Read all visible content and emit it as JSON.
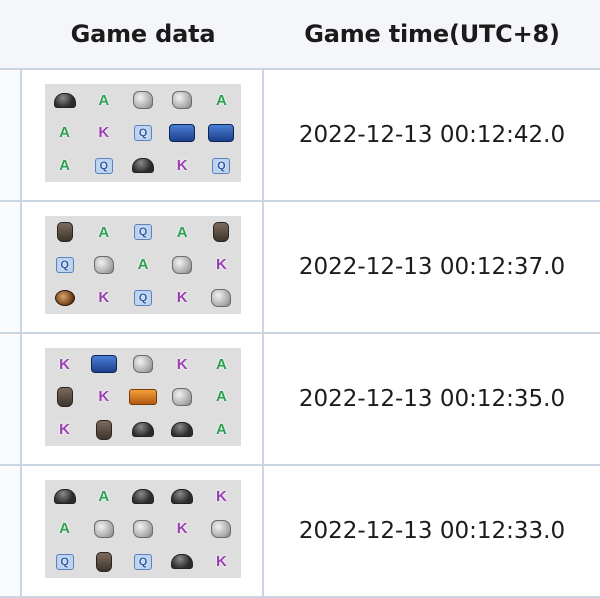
{
  "headers": {
    "game_data": "Game data",
    "game_time": "Game time(UTC+8)"
  },
  "rows": [
    {
      "time": "2022-12-13 00:12:42.0",
      "symbols": [
        [
          "helmet",
          "A",
          "rock",
          "rock",
          "A"
        ],
        [
          "A",
          "K",
          "Q",
          "wild",
          "wild"
        ],
        [
          "A",
          "Q",
          "helmet",
          "K",
          "Q"
        ]
      ]
    },
    {
      "time": "2022-12-13 00:12:37.0",
      "symbols": [
        [
          "bag",
          "A",
          "Q",
          "A",
          "bag"
        ],
        [
          "Q",
          "rock",
          "A",
          "rock",
          "K"
        ],
        [
          "bomb",
          "K",
          "Q",
          "K",
          "rock"
        ]
      ]
    },
    {
      "time": "2022-12-13 00:12:35.0",
      "symbols": [
        [
          "K",
          "wild",
          "rock",
          "K",
          "A"
        ],
        [
          "bag",
          "K",
          "scatter",
          "rock",
          "A"
        ],
        [
          "K",
          "bag",
          "helmet",
          "helmet",
          "A"
        ]
      ]
    },
    {
      "time": "2022-12-13 00:12:33.0",
      "symbols": [
        [
          "helmet",
          "A",
          "helmet",
          "helmet",
          "K"
        ],
        [
          "A",
          "rock",
          "rock",
          "K",
          "rock"
        ],
        [
          "Q",
          "bag",
          "Q",
          "helmet",
          "K"
        ]
      ]
    }
  ],
  "colors": {
    "letter_A": "#2e9e52",
    "letter_K": "#9a3fb3",
    "letter_Q": "#2b5aa6",
    "border": "#c9d6e2",
    "grid_background": "#dedede"
  }
}
